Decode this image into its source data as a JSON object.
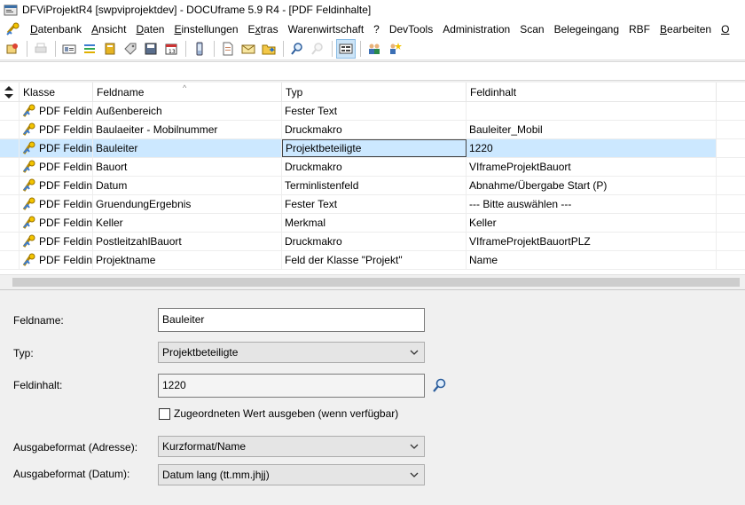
{
  "window": {
    "title": "DFViProjektR4 [swpviprojektdev] - DOCUframe 5.9 R4 - [PDF Feldinhalte]"
  },
  "menubar": {
    "items": [
      {
        "label": "Datenbank",
        "acc": "D"
      },
      {
        "label": "Ansicht",
        "acc": "A"
      },
      {
        "label": "Daten",
        "acc": "D"
      },
      {
        "label": "Einstellungen",
        "acc": "E"
      },
      {
        "label": "Extras",
        "acc": "x"
      },
      {
        "label": "Warenwirtschaft",
        "acc": ""
      },
      {
        "label": "?",
        "acc": ""
      },
      {
        "label": "DevTools",
        "acc": ""
      },
      {
        "label": "Administration",
        "acc": ""
      },
      {
        "label": "Scan",
        "acc": ""
      },
      {
        "label": "Belegeingang",
        "acc": ""
      },
      {
        "label": "RBF",
        "acc": ""
      },
      {
        "label": "Bearbeiten",
        "acc": "B"
      },
      {
        "label": "O",
        "acc": "O"
      }
    ]
  },
  "toolbar": {
    "icons": [
      "user-key-icon",
      "printer-icon",
      "id-card-icon",
      "list-color-icon",
      "book-icon",
      "tag-icon",
      "diskette-icon",
      "calendar-icon",
      "mobile-phone-icon",
      "document-icon",
      "envelope-icon",
      "folder-arrow-icon",
      "search-icon",
      "search-disabled-icon",
      "form-view-icon",
      "users-icon",
      "users-star-icon"
    ]
  },
  "grid": {
    "columns": [
      "Klasse",
      "Feldname",
      "Typ",
      "Feldinhalt"
    ],
    "rows": [
      {
        "klasse": "PDF Feldin",
        "feldname": "Außenbereich",
        "typ": "Fester Text",
        "feldinhalt": ""
      },
      {
        "klasse": "PDF Feldin",
        "feldname": "Baulaeiter - Mobilnummer",
        "typ": "Druckmakro",
        "feldinhalt": "Bauleiter_Mobil"
      },
      {
        "klasse": "PDF Feldin",
        "feldname": "Bauleiter",
        "typ": "Projektbeteiligte",
        "feldinhalt": "1220"
      },
      {
        "klasse": "PDF Feldin",
        "feldname": "Bauort",
        "typ": "Druckmakro",
        "feldinhalt": "VIframeProjektBauort"
      },
      {
        "klasse": "PDF Feldin",
        "feldname": "Datum",
        "typ": "Terminlistenfeld",
        "feldinhalt": "Abnahme/Übergabe Start (P)"
      },
      {
        "klasse": "PDF Feldin",
        "feldname": "GruendungErgebnis",
        "typ": "Fester Text",
        "feldinhalt": "--- Bitte auswählen ---"
      },
      {
        "klasse": "PDF Feldin",
        "feldname": "Keller",
        "typ": "Merkmal",
        "feldinhalt": "Keller"
      },
      {
        "klasse": "PDF Feldin",
        "feldname": "PostleitzahlBauort",
        "typ": "Druckmakro",
        "feldinhalt": "VIframeProjektBauortPLZ"
      },
      {
        "klasse": "PDF Feldin",
        "feldname": "Projektname",
        "typ": "Feld der Klasse \"Projekt\"",
        "feldinhalt": "Name"
      }
    ],
    "selected_row": "Bauleiter"
  },
  "form": {
    "feldname_label": "Feldname:",
    "feldname_value": "Bauleiter",
    "typ_label": "Typ:",
    "typ_value": "Projektbeteiligte",
    "feldinhalt_label": "Feldinhalt:",
    "feldinhalt_value": "1220",
    "checkbox_label": "Zugeordneten Wert ausgeben (wenn verfügbar)",
    "checkbox_checked": false,
    "adresse_label": "Ausgabeformat (Adresse):",
    "adresse_value": "Kurzformat/Name",
    "datum_label": "Ausgabeformat (Datum):",
    "datum_value": "Datum lang (tt.mm.jhjj)"
  },
  "colors": {
    "selection": "#cce8ff",
    "toolbar_active": "#cce4f7"
  }
}
